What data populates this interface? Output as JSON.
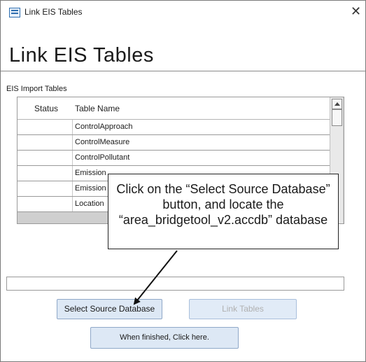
{
  "window": {
    "title": "Link EIS Tables",
    "close_glyph": "✕"
  },
  "form": {
    "heading": "Link EIS Tables"
  },
  "import_group": {
    "label": "EIS Import Tables",
    "columns": [
      "Status",
      "Table Name"
    ],
    "rows": [
      {
        "status": "",
        "name": "ControlApproach"
      },
      {
        "status": "",
        "name": "ControlMeasure"
      },
      {
        "status": "",
        "name": "ControlPollutant"
      },
      {
        "status": "",
        "name": "Emission"
      },
      {
        "status": "",
        "name": "Emission"
      },
      {
        "status": "",
        "name": "Location"
      }
    ]
  },
  "buttons": {
    "select_source": "Select Source Database",
    "link_tables": "Link Tables",
    "done": "When finished, Click here."
  },
  "callout": {
    "text": "Click on the “Select Source Database” button, and locate the “area_bridgetool_v2.accdb” database"
  },
  "icons": {
    "app": "access-form-icon",
    "close": "close-icon",
    "scroll_up": "scroll-up-arrow-icon",
    "pointer": "annotation-arrow-icon"
  },
  "colors": {
    "button_fill": "#dde8f5",
    "button_border": "#8fa8c8",
    "grid_background": "#cfcfcf",
    "disabled_text": "#b0b0b0"
  },
  "state": {
    "link_tables_enabled": false
  }
}
